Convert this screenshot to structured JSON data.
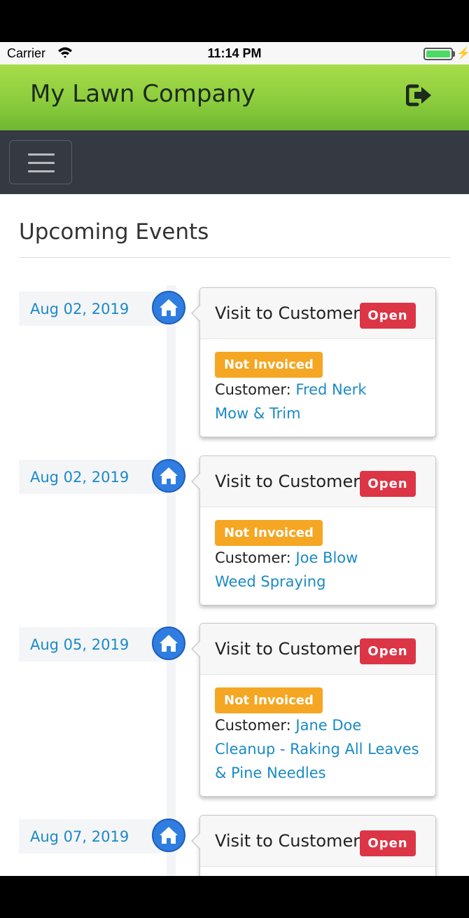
{
  "status_bar": {
    "carrier": "Carrier",
    "time": "11:14 PM"
  },
  "app": {
    "title": "My Lawn Company",
    "logout_icon": "sign-out-icon",
    "brand_color": "#8ccd3d"
  },
  "page": {
    "heading": "Upcoming Events"
  },
  "events": [
    {
      "date": "Aug 02, 2019",
      "title": "Visit to Customer",
      "status": "Open",
      "invoice": "Not Invoiced",
      "customer_label": "Customer:",
      "customer": "Fred Nerk",
      "service": "Mow & Trim"
    },
    {
      "date": "Aug 02, 2019",
      "title": "Visit to Customer",
      "status": "Open",
      "invoice": "Not Invoiced",
      "customer_label": "Customer:",
      "customer": "Joe Blow",
      "service": "Weed Spraying"
    },
    {
      "date": "Aug 05, 2019",
      "title": "Visit to Customer",
      "status": "Open",
      "invoice": "Not Invoiced",
      "customer_label": "Customer:",
      "customer": "Jane Doe",
      "service": "Cleanup - Raking All Leaves & Pine Needles"
    },
    {
      "date": "Aug 07, 2019",
      "title": "Visit to Customer",
      "status": "Open"
    }
  ]
}
